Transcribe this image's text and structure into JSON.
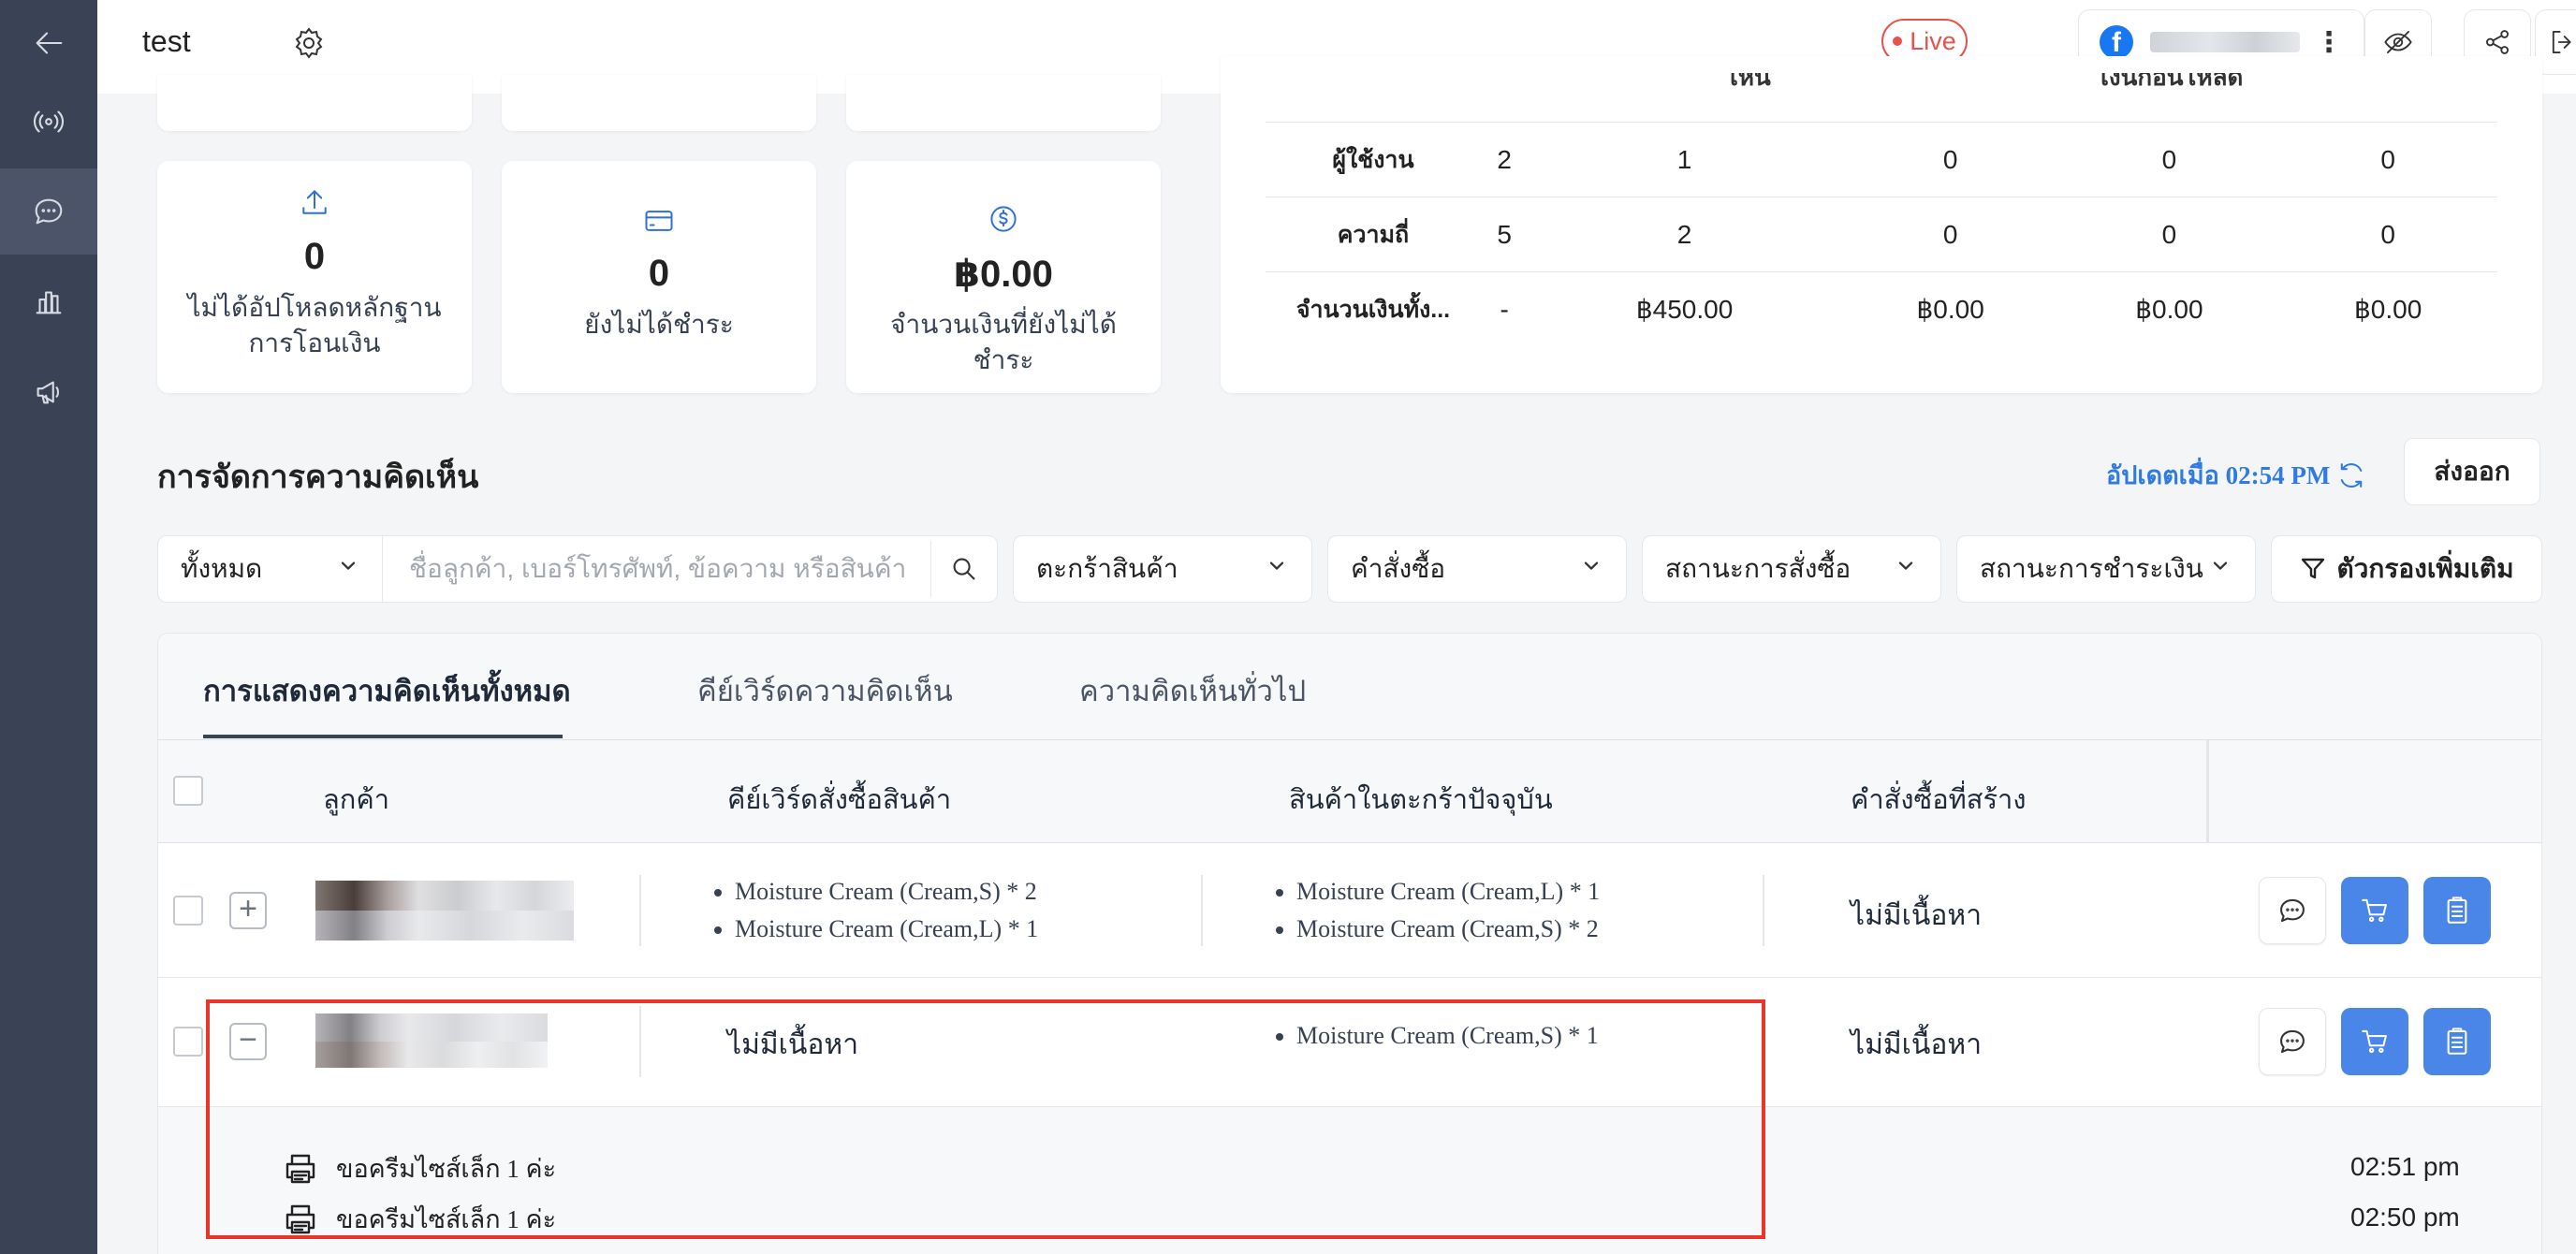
{
  "topbar": {
    "title": "test",
    "live_label": "Live",
    "fb_more": "⋮"
  },
  "stats_top_row_partial": true,
  "stats": [
    {
      "icon": "upload-icon",
      "value": "0",
      "label": "ไม่ได้อัปโหลดหลักฐานการโอนเงิน"
    },
    {
      "icon": "credit-card-icon",
      "value": "0",
      "label": "ยังไม่ได้ชำระ"
    },
    {
      "icon": "dollar-circle-icon",
      "value": "฿0.00",
      "label": "จำนวนเงินที่ยังไม่ได้ชำระ"
    }
  ],
  "summary": {
    "header_partial": [
      "เห็น",
      "เงินก่อนโหลด"
    ],
    "rows": [
      {
        "label": "ผู้ใช้งาน",
        "values": [
          "2",
          "1",
          "0",
          "0",
          "0"
        ]
      },
      {
        "label": "ความถี่",
        "values": [
          "5",
          "2",
          "0",
          "0",
          "0"
        ]
      },
      {
        "label": "จำนวนเงินทั้ง...",
        "values": [
          "-",
          "฿450.00",
          "฿0.00",
          "฿0.00",
          "฿0.00"
        ]
      }
    ]
  },
  "section": {
    "title": "การจัดการความคิดเห็น",
    "updated": "อัปเดตเมื่อ 02:54 PM",
    "export": "ส่งออก"
  },
  "filters": {
    "scope": "ทั้งหมด",
    "search_placeholder": "ชื่อลูกค้า, เบอร์โทรศัพท์, ข้อความ หรือสินค้า",
    "cart": "ตะกร้าสินค้า",
    "order": "คำสั่งซื้อ",
    "order_status": "สถานะการสั่งซื้อ",
    "payment_status": "สถานะการชำระเงิน",
    "more_filters": "ตัวกรองเพิ่มเติม"
  },
  "tabs": [
    {
      "label": "การแสดงความคิดเห็นทั้งหมด",
      "active": true
    },
    {
      "label": "คีย์เวิร์ดความคิดเห็น",
      "active": false
    },
    {
      "label": "ความคิดเห็นทั่วไป",
      "active": false
    }
  ],
  "columns": {
    "customer": "ลูกค้า",
    "keywords": "คีย์เวิร์ดสั่งซื้อสินค้า",
    "cart": "สินค้าในตะกร้าปัจจุบัน",
    "orders": "คำสั่งซื้อที่สร้าง"
  },
  "rows": [
    {
      "expander": "+",
      "keywords": [
        "Moisture Cream (Cream,S) * 2",
        "Moisture Cream (Cream,L) * 1"
      ],
      "cart": [
        "Moisture Cream (Cream,L) * 1",
        "Moisture Cream (Cream,S) * 2"
      ],
      "orders": "ไม่มีเนื้อหา"
    },
    {
      "expander": "−",
      "keywords_empty": "ไม่มีเนื้อหา",
      "cart": [
        "Moisture Cream (Cream,S) * 1"
      ],
      "orders": "ไม่มีเนื้อหา"
    }
  ],
  "comments": [
    {
      "text": "ขอครีมไซส์เล็ก 1 ค่ะ",
      "time": "02:51 pm"
    },
    {
      "text": "ขอครีมไซส์เล็ก 1 ค่ะ",
      "time": "02:50 pm"
    }
  ],
  "colors": {
    "sidebar": "#3a4256",
    "accent_blue": "#4a86e8",
    "live_red": "#e5534b",
    "highlight_red": "#e8362b"
  }
}
